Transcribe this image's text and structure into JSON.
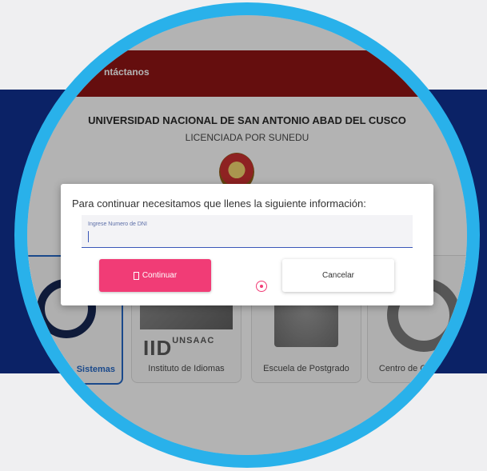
{
  "header": {
    "nav_link": "ntáctanos"
  },
  "university": {
    "title": "UNIVERSIDAD NACIONAL DE SAN ANTONIO ABAD DEL CUSCO",
    "subtitle": "LICENCIADA POR SUNEDU"
  },
  "cards": [
    {
      "label": "Sistemas"
    },
    {
      "label": "Instituto de Idiomas",
      "logo_text": "IID",
      "logo_sub": "UNSAAC"
    },
    {
      "label": "Escuela de Postgrado"
    },
    {
      "label": "Centro de C... en Inf..."
    }
  ],
  "dialog": {
    "message": "Para continuar necesitamos que llenes la siguiente información:",
    "dni_label": "Ingrese Numero de DNI",
    "dni_value": "",
    "continue_label": "Continuar",
    "cancel_label": "Cancelar"
  },
  "colors": {
    "navy": "#0b2266",
    "ring": "#29b1ea",
    "topbar": "#8c0d0d",
    "accent": "#f13c76"
  }
}
